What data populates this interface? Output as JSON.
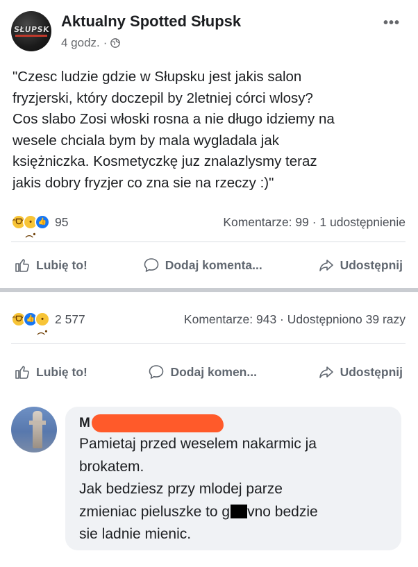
{
  "post": {
    "page_name": "Aktualny Spotted Słupsk",
    "avatar_text": "SŁUPSK",
    "time": "4 godz.",
    "separator": "·",
    "lines": [
      "\"Czesc ludzie gdzie w Słupsku jest jakis salon",
      "fryzjerski, który doczepil by 2letniej córci wlosy?",
      "Cos slabo Zosi włoski rosna a nie długo idziemy na",
      "wesele chciala bym by mala wygladala jak",
      "księżniczka. Kosmetyczkę juz znalazlysmy teraz",
      "jakis dobry fryzjer co zna sie na rzeczy :)\""
    ],
    "reaction_count": "95",
    "stats_right": "Komentarze: 99 · 1 udostępnienie",
    "actions": {
      "like": "Lubię to!",
      "comment": "Dodaj komenta...",
      "share": "Udostępnij"
    }
  },
  "shared_post": {
    "reaction_count": "2 577",
    "stats_right": "Komentarze: 943 · Udostępniono 39 razy",
    "actions": {
      "like": "Lubię to!",
      "comment": "Dodaj komen...",
      "share": "Udostępnij"
    }
  },
  "comment": {
    "author_initial": "M",
    "line1": "Pamietaj przed weselem nakarmic ja",
    "line2": "brokatem.",
    "line3": "Jak bedziesz przy mlodej parze",
    "line4_before": "zmieniac pieluszke to g",
    "line4_after": "vno bedzie",
    "line5": "sie ladnie mienic."
  },
  "colors": {
    "like_blue": "#1877f2",
    "reaction_yellow": "#f7c437",
    "redaction_orange": "#ff5a2a",
    "divider_gray": "#c9ccd1",
    "bubble_gray": "#f0f2f5"
  },
  "icons": [
    "globe-icon",
    "more-icon",
    "like-icon",
    "comment-icon",
    "share-icon",
    "haha-reaction-icon",
    "sad-reaction-icon",
    "like-reaction-icon"
  ]
}
